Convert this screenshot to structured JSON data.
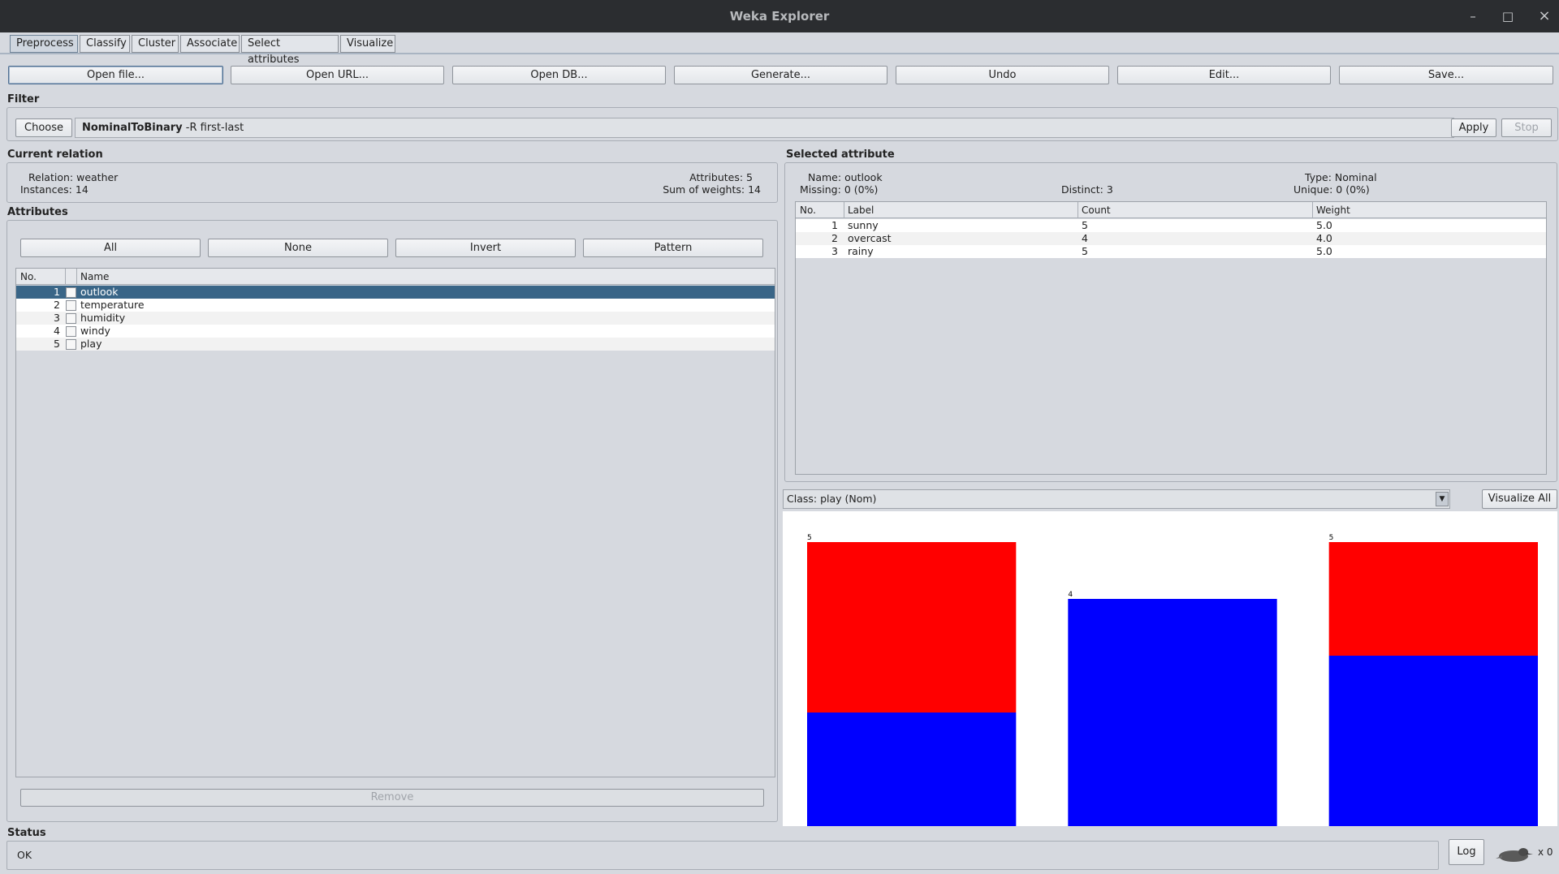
{
  "window": {
    "title": "Weka Explorer",
    "minimize": "–",
    "maximize": "□",
    "close": "×"
  },
  "tabs": [
    "Preprocess",
    "Classify",
    "Cluster",
    "Associate",
    "Select attributes",
    "Visualize"
  ],
  "toolbar": [
    "Open file...",
    "Open URL...",
    "Open DB...",
    "Generate...",
    "Undo",
    "Edit...",
    "Save..."
  ],
  "filter": {
    "section": "Filter",
    "choose": "Choose",
    "name": "NominalToBinary",
    "options": "-R first-last",
    "apply": "Apply",
    "stop": "Stop"
  },
  "current_relation": {
    "section": "Current relation",
    "relation_label": "Relation:",
    "relation_value": "weather",
    "instances_label": "Instances:",
    "instances_value": "14",
    "attributes_label": "Attributes:",
    "attributes_value": "5",
    "sow_label": "Sum of weights:",
    "sow_value": "14"
  },
  "attributes": {
    "section": "Attributes",
    "buttons": [
      "All",
      "None",
      "Invert",
      "Pattern"
    ],
    "col_no": "No.",
    "col_name": "Name",
    "rows": [
      {
        "no": "1",
        "name": "outlook"
      },
      {
        "no": "2",
        "name": "temperature"
      },
      {
        "no": "3",
        "name": "humidity"
      },
      {
        "no": "4",
        "name": "windy"
      },
      {
        "no": "5",
        "name": "play"
      }
    ],
    "selected_index": 0,
    "remove": "Remove"
  },
  "selected_attribute": {
    "section": "Selected attribute",
    "name_label": "Name:",
    "name_value": "outlook",
    "type_label": "Type:",
    "type_value": "Nominal",
    "missing_label": "Missing:",
    "missing_value": "0 (0%)",
    "distinct_label": "Distinct:",
    "distinct_value": "3",
    "unique_label": "Unique:",
    "unique_value": "0 (0%)",
    "columns": [
      "No.",
      "Label",
      "Count",
      "Weight"
    ],
    "rows": [
      {
        "no": "1",
        "label": "sunny",
        "count": "5",
        "weight": "5.0"
      },
      {
        "no": "2",
        "label": "overcast",
        "count": "4",
        "weight": "4.0"
      },
      {
        "no": "3",
        "label": "rainy",
        "count": "5",
        "weight": "5.0"
      }
    ]
  },
  "class_selector": {
    "value": "Class: play (Nom)",
    "visualize_all": "Visualize All"
  },
  "chart_data": {
    "type": "bar",
    "stacked": true,
    "categories": [
      "sunny",
      "overcast",
      "rainy"
    ],
    "series": [
      {
        "color": "#0000ff",
        "values": [
          2,
          4,
          3
        ]
      },
      {
        "color": "#ff0000",
        "values": [
          3,
          0,
          2
        ]
      }
    ],
    "totals": [
      5,
      4,
      5
    ],
    "ylim": [
      0,
      5
    ]
  },
  "status": {
    "section": "Status",
    "text": "OK",
    "log": "Log",
    "count": "x 0"
  }
}
